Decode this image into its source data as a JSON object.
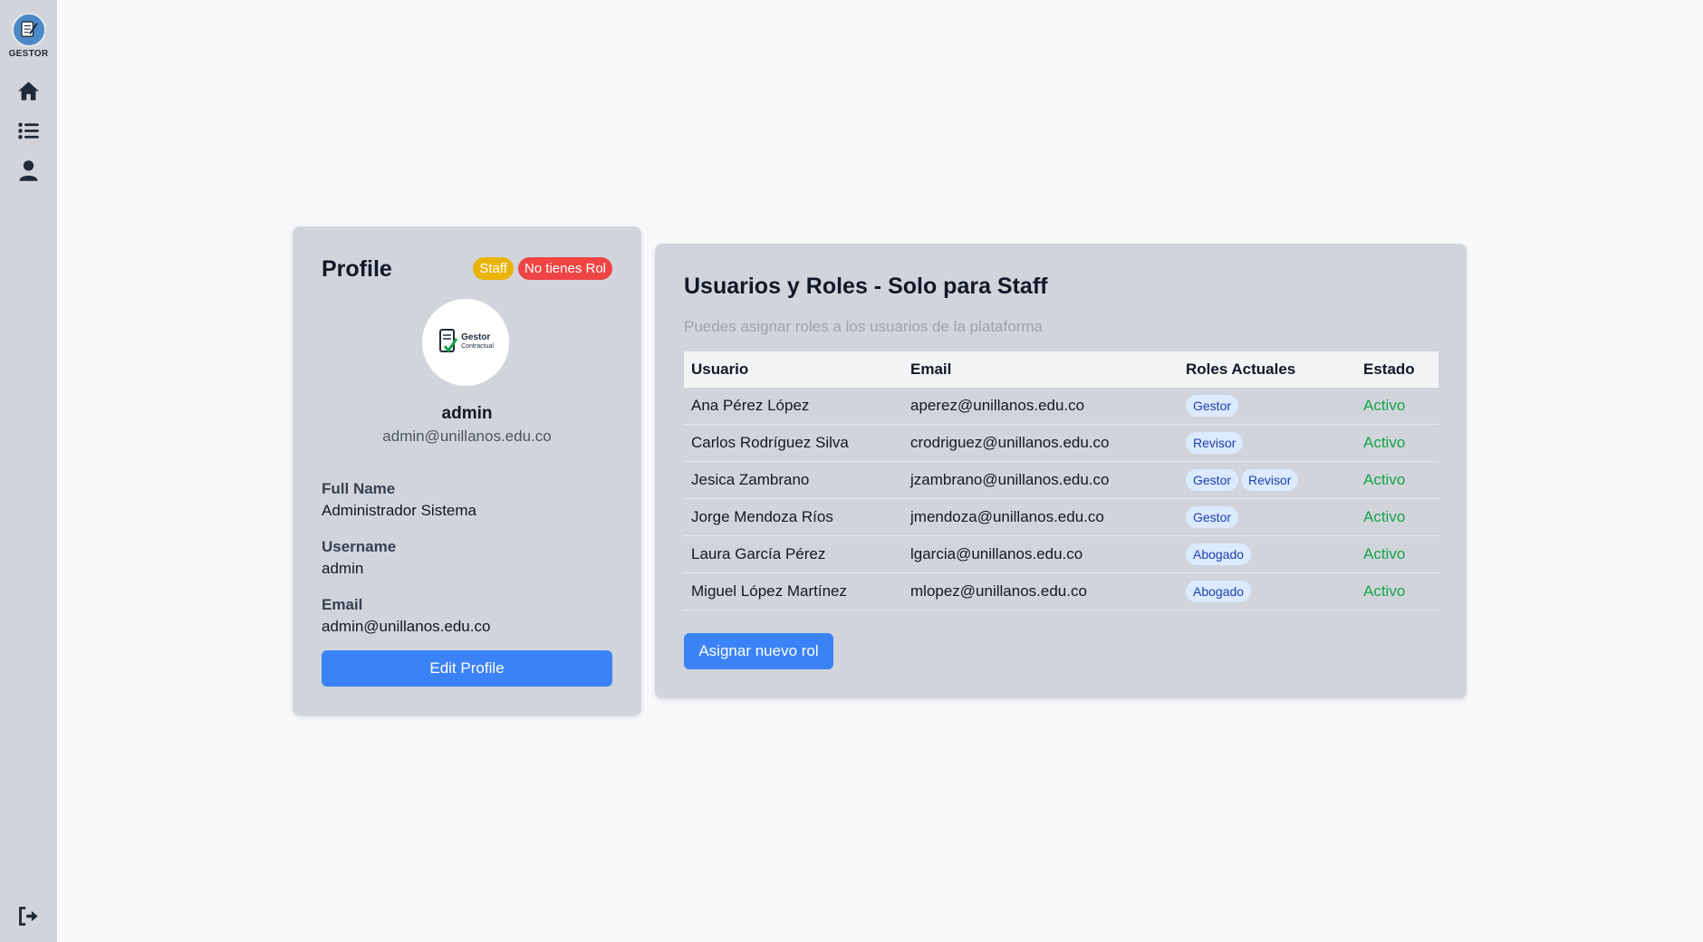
{
  "app": {
    "logo_text": "GESTOR"
  },
  "sidebar": {
    "items": [
      {
        "icon": "home-icon"
      },
      {
        "icon": "list-icon"
      },
      {
        "icon": "user-icon"
      }
    ],
    "logout_icon": "logout-icon"
  },
  "profile": {
    "title": "Profile",
    "badges": {
      "staff": "Staff",
      "no_role": "No tienes Rol"
    },
    "avatar_text": {
      "line1": "Gestor",
      "line2": "Contractual"
    },
    "username": "admin",
    "email": "admin@unillanos.edu.co",
    "fields": {
      "full_name_label": "Full Name",
      "full_name_value": "Administrador Sistema",
      "username_label": "Username",
      "username_value": "admin",
      "email_label": "Email",
      "email_value": "admin@unillanos.edu.co"
    },
    "edit_button": "Edit Profile"
  },
  "users_panel": {
    "title": "Usuarios y Roles - Solo para Staff",
    "subtitle": "Puedes asignar roles a los usuarios de la plataforma",
    "columns": [
      "Usuario",
      "Email",
      "Roles Actuales",
      "Estado"
    ],
    "rows": [
      {
        "usuario": "Ana Pérez López",
        "email": "aperez@unillanos.edu.co",
        "roles": [
          "Gestor"
        ],
        "estado": "Activo"
      },
      {
        "usuario": "Carlos Rodríguez Silva",
        "email": "crodriguez@unillanos.edu.co",
        "roles": [
          "Revisor"
        ],
        "estado": "Activo"
      },
      {
        "usuario": "Jesica Zambrano",
        "email": "jzambrano@unillanos.edu.co",
        "roles": [
          "Gestor",
          "Revisor"
        ],
        "estado": "Activo"
      },
      {
        "usuario": "Jorge Mendoza Ríos",
        "email": "jmendoza@unillanos.edu.co",
        "roles": [
          "Gestor"
        ],
        "estado": "Activo"
      },
      {
        "usuario": "Laura García Pérez",
        "email": "lgarcia@unillanos.edu.co",
        "roles": [
          "Abogado"
        ],
        "estado": "Activo"
      },
      {
        "usuario": "Miguel López Martínez",
        "email": "mlopez@unillanos.edu.co",
        "roles": [
          "Abogado"
        ],
        "estado": "Activo"
      }
    ],
    "assign_button": "Asignar nuevo rol"
  }
}
